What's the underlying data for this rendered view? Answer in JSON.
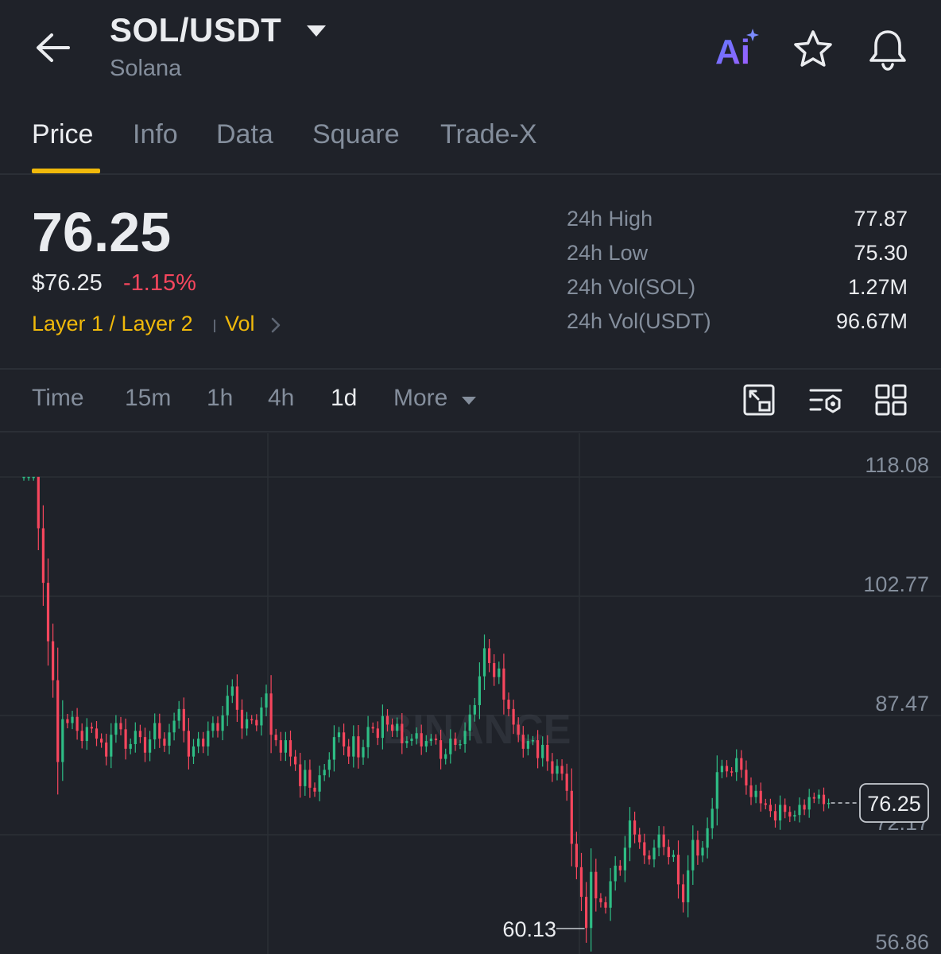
{
  "header": {
    "pair": "SOL/USDT",
    "name": "Solana",
    "icons": {
      "back": "arrow-left-icon",
      "dropdown": "caret-down-icon",
      "ai": "ai-icon",
      "favorite": "star-icon",
      "alert": "bell-icon"
    },
    "ai_label": "Ai"
  },
  "tabs": [
    {
      "label": "Price",
      "active": true
    },
    {
      "label": "Info"
    },
    {
      "label": "Data"
    },
    {
      "label": "Square"
    },
    {
      "label": "Trade-X"
    }
  ],
  "price": {
    "last": "76.25",
    "usd": "$76.25",
    "change": "-1.15%",
    "tag_sector": "Layer 1 / Layer 2",
    "tag_vol": "Vol",
    "stats": [
      {
        "label": "24h High",
        "value": "77.87"
      },
      {
        "label": "24h Low",
        "value": "75.30"
      },
      {
        "label": "24h Vol(SOL)",
        "value": "1.27M"
      },
      {
        "label": "24h Vol(USDT)",
        "value": "96.67M"
      }
    ]
  },
  "intervals": {
    "items": [
      "Time",
      "15m",
      "1h",
      "4h",
      "1d",
      "More"
    ],
    "active": "1d",
    "tools": [
      "chart-fullscreen-icon",
      "indicator-settings-icon",
      "grid-layout-icon"
    ]
  },
  "chart_data": {
    "type": "candlestick",
    "y_ticks": [
      "118.08",
      "102.77",
      "87.47",
      "72.17",
      "56.86"
    ],
    "ylim": [
      56.86,
      118.08
    ],
    "current_price": "76.25",
    "low_marker": "60.13",
    "watermark": "BINANCE",
    "colors": {
      "up": "#2ebd85",
      "down": "#f6465d",
      "grid": "#2b2f36"
    },
    "closes": [
      118.1,
      118.1,
      118.1,
      111.5,
      104.5,
      97,
      92,
      81.5,
      87,
      86.5,
      87.3,
      85.5,
      84.2,
      86,
      85.8,
      84.5,
      84,
      82.2,
      85,
      86.5,
      85.7,
      83.2,
      83.8,
      85.5,
      84.7,
      82.7,
      84.4,
      86.5,
      84.5,
      83.6,
      85.3,
      86.8,
      88.3,
      85.5,
      82.2,
      83.5,
      84.5,
      83.5,
      85.5,
      86.5,
      85.5,
      87.5,
      90,
      91.2,
      88.2,
      85.8,
      87,
      86.9,
      86.2,
      88.5,
      90.3,
      85,
      84.3,
      82.7,
      84.3,
      82.2,
      81.2,
      78.4,
      80.5,
      78.2,
      77.7,
      79.8,
      80.5,
      81.8,
      84.7,
      85.3,
      83.5,
      82.2,
      84.8,
      82.1,
      83.4,
      86,
      85.8,
      84.6,
      87.4,
      86.3,
      85.5,
      86.4,
      83.9,
      84.2,
      84.5,
      85.2,
      83.5,
      84.2,
      84.5,
      84.3,
      81.9,
      82.5,
      84.5,
      83.7,
      83.8,
      85.5,
      87.6,
      88.8,
      92.5,
      96.1,
      94.2,
      92.4,
      93.5,
      89.5,
      88.3,
      86.3,
      85,
      83.2,
      84.2,
      84.3,
      82,
      83.7,
      81.6,
      80,
      81,
      80,
      77.8,
      71,
      68,
      64.2,
      60.2,
      67.4,
      64,
      63.5,
      62.8,
      66.2,
      68.2,
      67.6,
      70.5,
      74,
      72.2,
      71.2,
      69.5,
      69,
      70.5,
      72.2,
      70.6,
      69.3,
      69.6,
      65.8,
      63.5,
      67.6,
      71.5,
      69.5,
      70.5,
      73,
      75.5,
      80.2,
      81,
      80.3,
      80.2,
      82,
      80.5,
      78.5,
      77,
      77.8,
      76.2,
      76,
      75.2,
      74,
      76,
      75.1,
      74.5,
      74.7,
      76,
      75.4,
      77,
      76.8,
      77.3,
      76.1,
      76.25
    ]
  }
}
